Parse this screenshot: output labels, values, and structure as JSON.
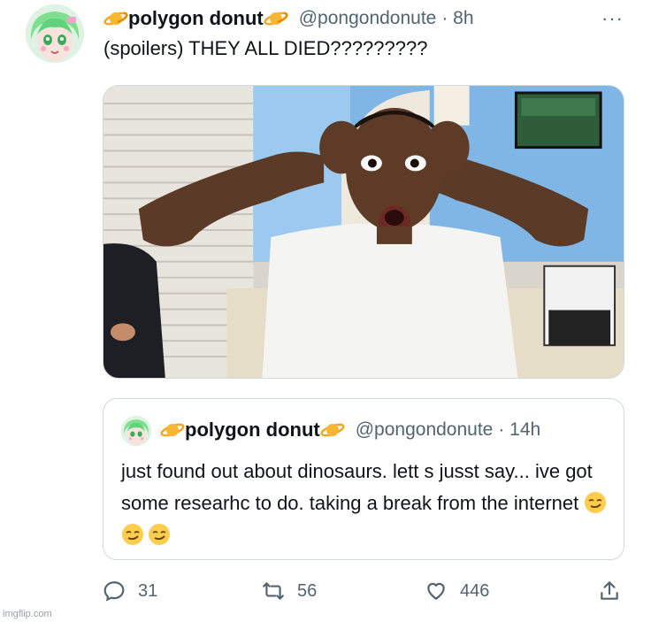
{
  "tweet": {
    "author_name": "polygon donut",
    "handle": "@pongondonute",
    "time": "· 8h",
    "text": "(spoilers) THEY ALL DIED?????????",
    "more_label": "···"
  },
  "quoted": {
    "author_name": "polygon donut",
    "handle": "@pongondonute",
    "time": "· 14h",
    "text": "just found out about dinosaurs. lett s jusst say... ive got some researhc to do. taking a break from the internet",
    "emoji": [
      "smirk-emoji",
      "smirk-emoji",
      "smirk-emoji"
    ]
  },
  "actions": {
    "replies": "31",
    "retweets": "56",
    "likes": "446"
  },
  "watermark": "imgflip.com",
  "colors": {
    "text": "#0f1419",
    "secondary": "#536471",
    "border": "#cfd9de",
    "planet": "#f5a623"
  }
}
